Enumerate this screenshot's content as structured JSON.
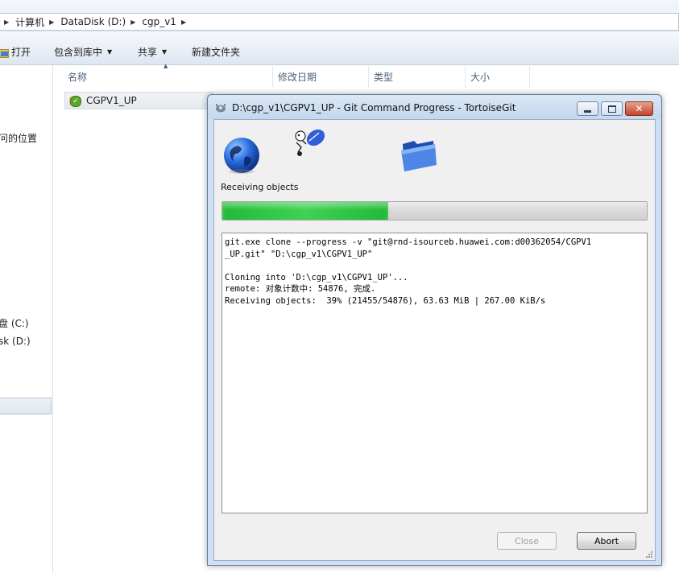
{
  "explorer": {
    "breadcrumbs": [
      "计算机",
      "DataDisk (D:)",
      "cgp_v1"
    ],
    "toolbar": {
      "open_label": "打开",
      "include_library_label": "包含到库中",
      "share_label": "共享",
      "new_folder_label": "新建文件夹"
    },
    "columns": [
      "名称",
      "修改日期",
      "类型",
      "大小"
    ],
    "nav": {
      "recent_places": "问的位置",
      "drive_c": "盘 (C:)",
      "drive_d": "sk (D:)"
    },
    "file": {
      "name": "CGPV1_UP"
    }
  },
  "dialog": {
    "title": "D:\\cgp_v1\\CGPV1_UP - Git Command Progress - TortoiseGit",
    "status": "Receiving objects",
    "progress_percent": 39,
    "log_lines": [
      "git.exe clone --progress -v \"git@rnd-isourceb.huawei.com:d00362054/CGPV1",
      "_UP.git\" \"D:\\cgp_v1\\CGPV1_UP\"",
      "",
      "Cloning into 'D:\\cgp_v1\\CGPV1_UP'...",
      "remote: 对象计数中: 54876, 完成.",
      "Receiving objects:  39% (21455/54876), 63.63 MiB | 267.00 KiB/s"
    ],
    "close_label": "Close",
    "abort_label": "Abort"
  },
  "icons": {
    "globe": "globe-icon",
    "transfer": "git-transfer-icon",
    "folder": "folder-icon"
  },
  "colors": {
    "progress_green": "#21b838",
    "titlebar": "#c3d7ee",
    "close_button": "#c7422b"
  }
}
